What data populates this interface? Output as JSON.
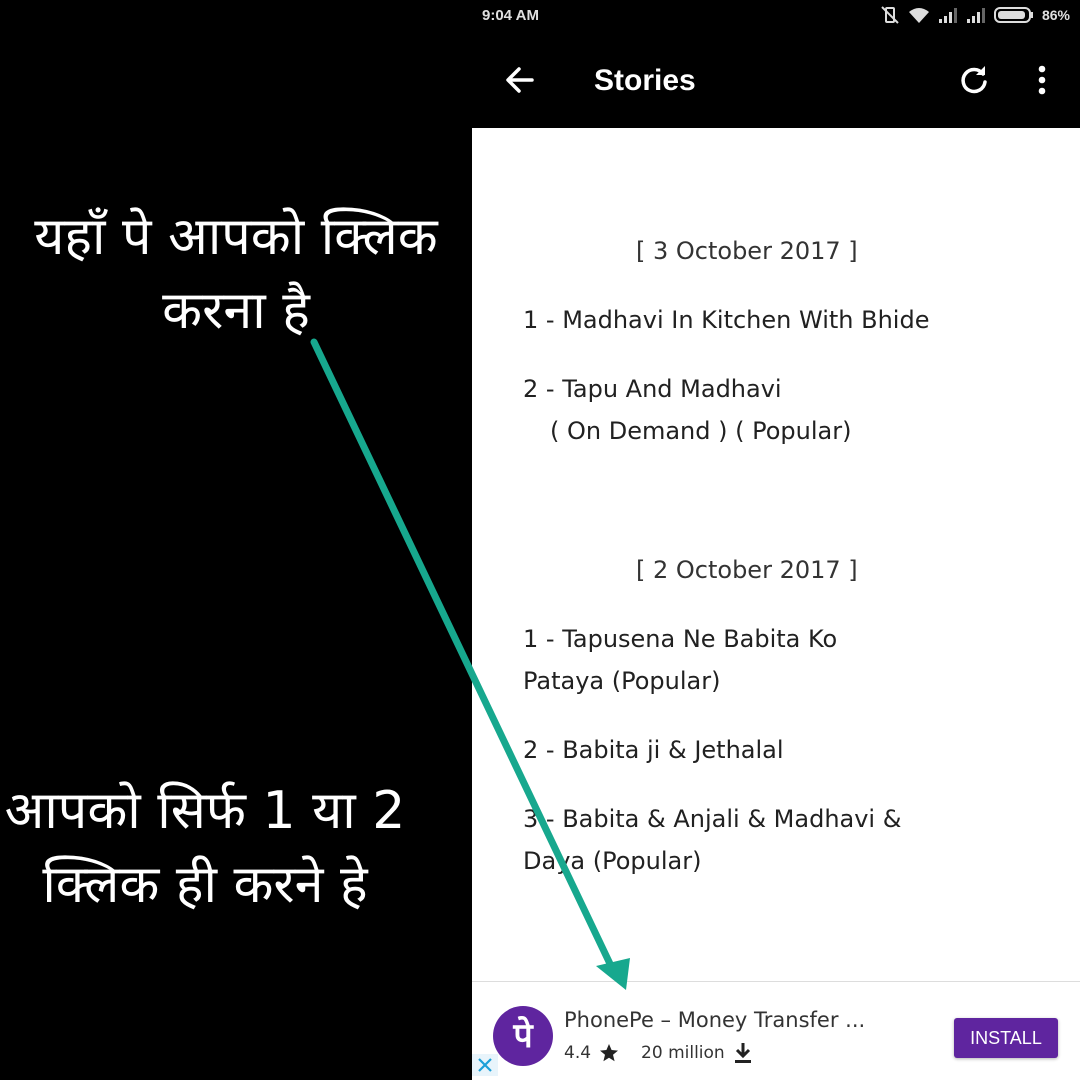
{
  "overlay": {
    "hint_top": "यहाँ पे आपको क्लिक करना है",
    "hint_bottom": "आपको सिर्फ 1 या 2 क्लिक ही करने हे",
    "arrow_color": "#17a88e"
  },
  "status_bar": {
    "time": "9:04 AM",
    "battery": "86%"
  },
  "app_bar": {
    "title": "Stories",
    "back_icon": "arrow-left-icon",
    "refresh_icon": "refresh-icon",
    "more_icon": "more-vertical-icon"
  },
  "stories": {
    "sections": [
      {
        "date": "[ 3 October 2017 ]",
        "items": [
          "1 - Madhavi In Kitchen With Bhide",
          "2 - Tapu And Madhavi",
          "( On Demand ) ( Popular)"
        ]
      },
      {
        "date": "[ 2 October 2017 ]",
        "items": [
          "1 - Tapusena Ne Babita Ko",
          "Pataya (Popular)",
          "2 - Babita ji & Jethalal",
          "3 - Babita & Anjali & Madhavi &",
          "Daya  (Popular)"
        ]
      }
    ]
  },
  "ad": {
    "logo_text": "पे",
    "title": "PhonePe – Money Transfer ...",
    "rating": "4.4",
    "downloads": "20 million",
    "install_label": "INSTALL",
    "brand_color": "#5f259f"
  }
}
